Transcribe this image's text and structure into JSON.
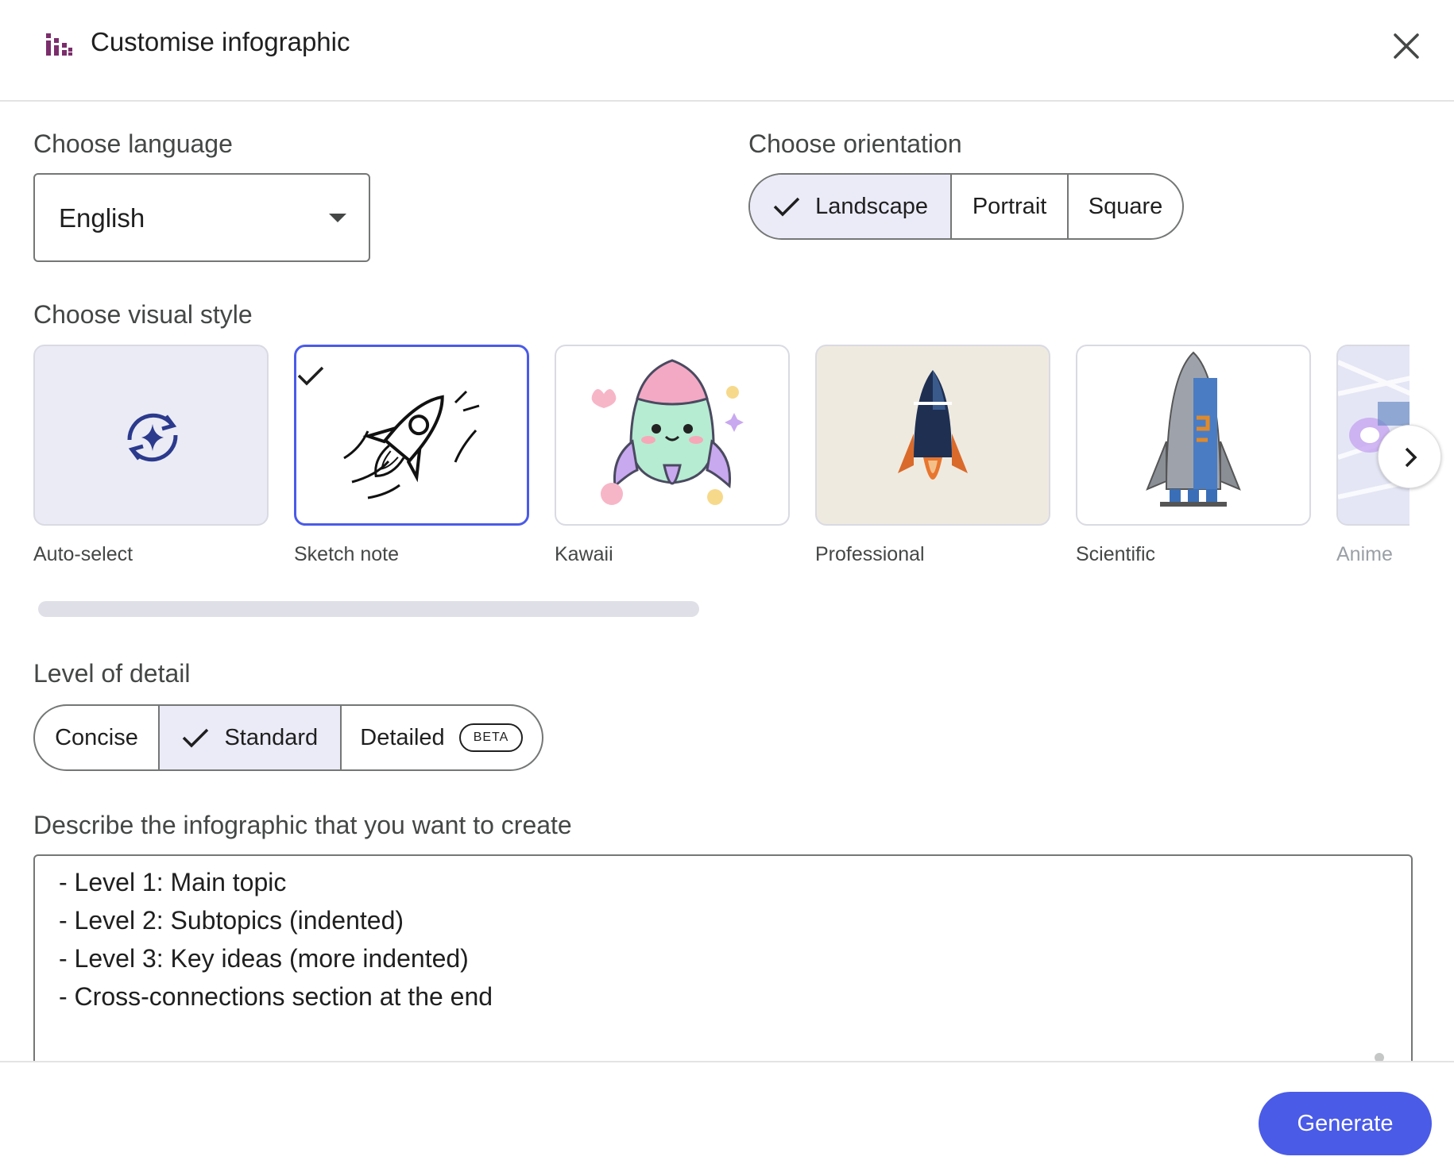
{
  "dialog": {
    "title": "Customise infographic",
    "icon": "infographic-bars-icon",
    "close_icon": "close-icon"
  },
  "language": {
    "label": "Choose language",
    "selected": "English"
  },
  "orientation": {
    "label": "Choose orientation",
    "options": [
      "Landscape",
      "Portrait",
      "Square"
    ],
    "selected": "Landscape"
  },
  "visual_style": {
    "label": "Choose visual style",
    "styles": [
      {
        "label": "Auto-select",
        "icon": "auto-sparkle-refresh-icon"
      },
      {
        "label": "Sketch note",
        "icon": "rocket-sketch-icon"
      },
      {
        "label": "Kawaii",
        "icon": "rocket-kawaii-icon"
      },
      {
        "label": "Professional",
        "icon": "rocket-professional-icon"
      },
      {
        "label": "Scientific",
        "icon": "rocket-scientific-icon"
      },
      {
        "label": "Anime",
        "icon": "rocket-anime-icon"
      }
    ],
    "selected": "Sketch note",
    "next_icon": "chevron-right-icon"
  },
  "detail": {
    "label": "Level of detail",
    "options": [
      "Concise",
      "Standard",
      "Detailed"
    ],
    "selected": "Standard",
    "badge": "BETA"
  },
  "description": {
    "label": "Describe the infographic that you want to create",
    "lines": [
      "- Level 1: Main topic",
      "- Level 2: Subtopics (indented)",
      "- Level 3: Key ideas (more indented)",
      "- Cross-connections section at the end"
    ]
  },
  "footer": {
    "generate_label": "Generate"
  },
  "colors": {
    "accent": "#4a5be8",
    "selected_bg": "#ebebf8",
    "icon_purple": "#7b2d6b"
  }
}
